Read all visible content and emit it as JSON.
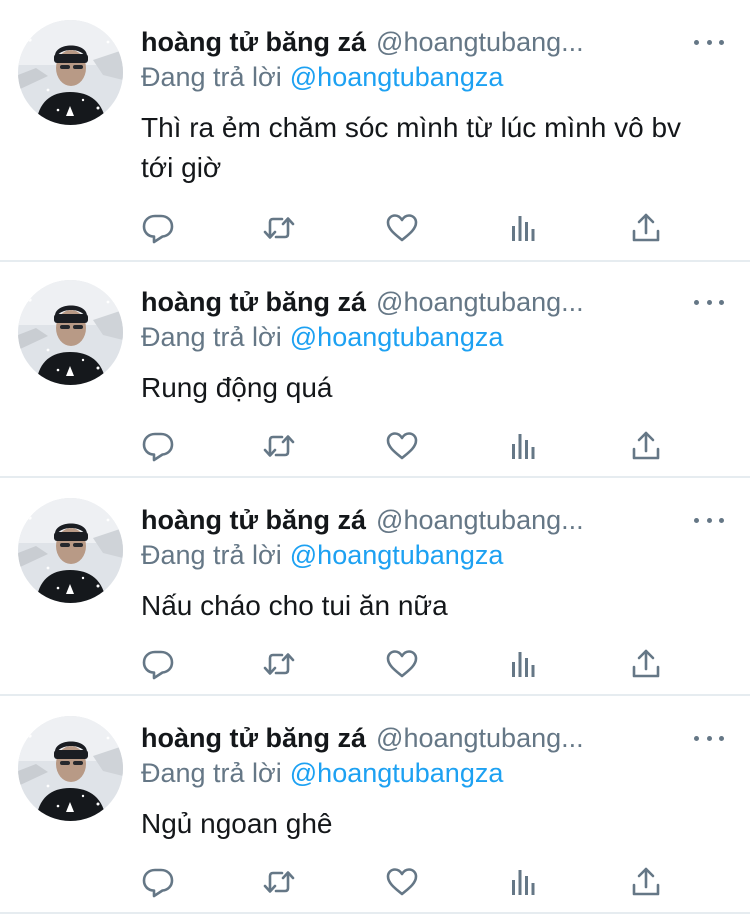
{
  "colors": {
    "text_primary": "#14171a",
    "text_secondary": "#657786",
    "link": "#1da1f2",
    "divider": "#e6ecf0"
  },
  "tweets": [
    {
      "display_name": "hoàng tử băng zá",
      "handle": "@hoangtubang...",
      "reply_prefix": "Đang trả lời",
      "reply_mention": "@hoangtubangza",
      "text": "Thì ra ẻm chăm sóc mình từ lúc mình vô bv tới giờ",
      "icons": [
        "reply-icon",
        "retweet-icon",
        "like-icon",
        "analytics-icon",
        "share-icon"
      ]
    },
    {
      "display_name": "hoàng tử băng zá",
      "handle": "@hoangtubang...",
      "reply_prefix": "Đang trả lời",
      "reply_mention": "@hoangtubangza",
      "text": "Rung động quá",
      "icons": [
        "reply-icon",
        "retweet-icon",
        "like-icon",
        "analytics-icon",
        "share-icon"
      ]
    },
    {
      "display_name": "hoàng tử băng zá",
      "handle": "@hoangtubang...",
      "reply_prefix": "Đang trả lời",
      "reply_mention": "@hoangtubangza",
      "text": "Nấu cháo cho tui ăn nữa",
      "icons": [
        "reply-icon",
        "retweet-icon",
        "like-icon",
        "analytics-icon",
        "share-icon"
      ]
    },
    {
      "display_name": "hoàng tử băng zá",
      "handle": "@hoangtubang...",
      "reply_prefix": "Đang trả lời",
      "reply_mention": "@hoangtubangza",
      "text": "Ngủ ngoan ghê",
      "icons": [
        "reply-icon",
        "retweet-icon",
        "like-icon",
        "analytics-icon",
        "share-icon"
      ]
    }
  ]
}
